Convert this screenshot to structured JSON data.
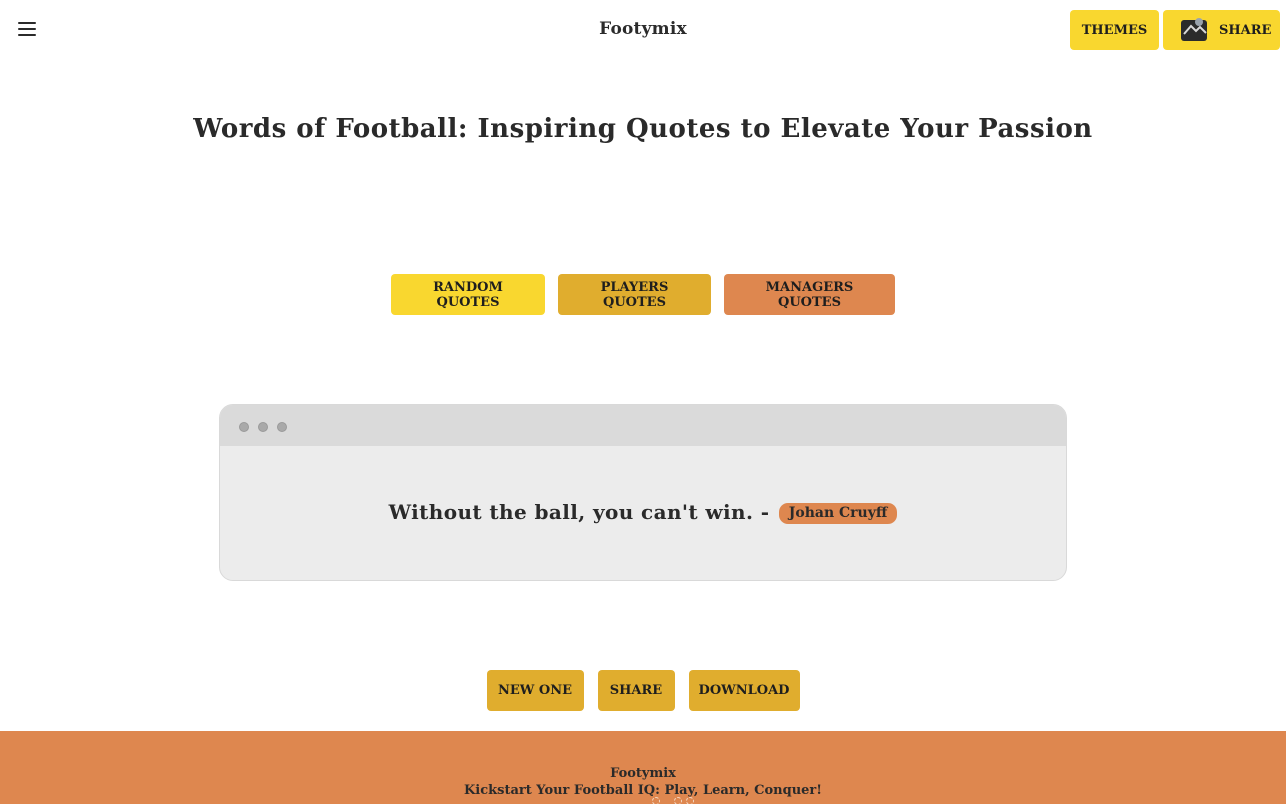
{
  "header": {
    "menu_icon": "hamburger-menu-icon",
    "brand": "Footymix",
    "themes_label": "THEMES",
    "share_label": "SHARE",
    "share_icon": "share-image-icon"
  },
  "page": {
    "headline": "Words of Football: Inspiring Quotes to Elevate Your Passion"
  },
  "categories": [
    {
      "label": "RANDOM QUOTES",
      "color": "#f9d72f"
    },
    {
      "label": "PLAYERS QUOTES",
      "color": "#e0ad2e"
    },
    {
      "label": "MANAGERS QUOTES",
      "color": "#de874f"
    }
  ],
  "quote_card": {
    "text": "Without the ball, you can't win. -",
    "author": "Johan Cruyff"
  },
  "actions": {
    "new_label": "NEW ONE",
    "share_label": "SHARE",
    "download_label": "DOWNLOAD"
  },
  "footer": {
    "title": "Footymix",
    "tagline": "Kickstart Your Football IQ: Play, Learn, Conquer!"
  },
  "colors": {
    "yellow": "#f9d72f",
    "gold": "#e0ad2e",
    "orange": "#de874f",
    "card_bg": "#ececec",
    "card_header": "#dadada"
  }
}
